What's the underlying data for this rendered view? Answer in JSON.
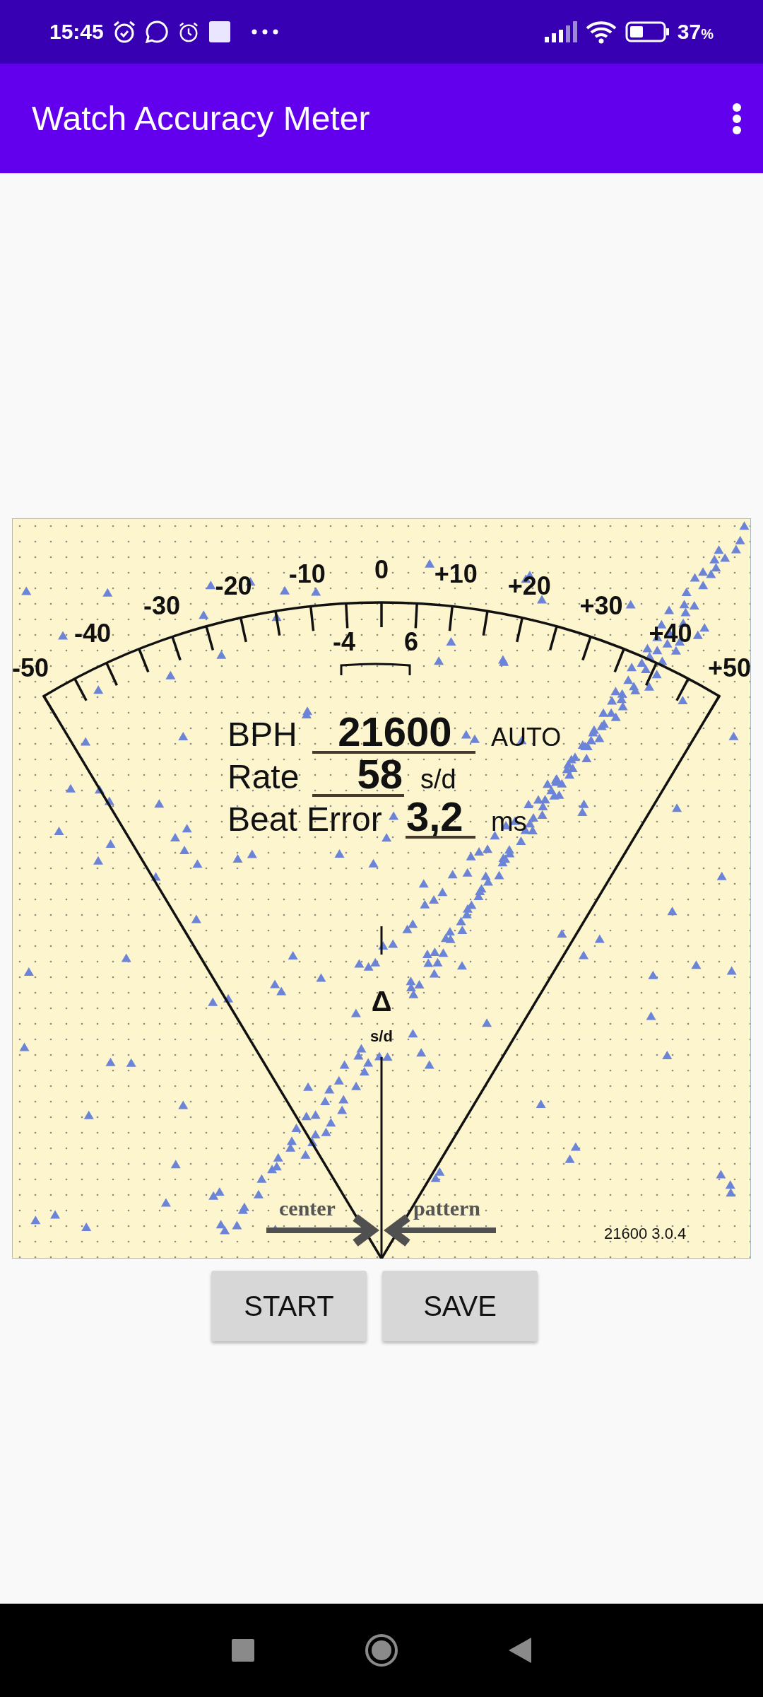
{
  "status_bar": {
    "time": "15:45",
    "battery": "37",
    "battery_unit": "%"
  },
  "app_bar": {
    "title": "Watch Accuracy Meter"
  },
  "dial": {
    "scale_labels": [
      "-50",
      "-40",
      "-30",
      "-20",
      "-10",
      "0",
      "+10",
      "+20",
      "+30",
      "+40",
      "+50"
    ],
    "bracket_labels": [
      "-4",
      "6"
    ],
    "readings": [
      {
        "label": "BPH",
        "value": "21600",
        "unit": "AUTO"
      },
      {
        "label": "Rate",
        "value": "58",
        "unit": "s/d"
      },
      {
        "label": "Beat Error",
        "value": "3,2",
        "unit": "ms"
      }
    ],
    "delta_symbol": "Δ",
    "delta_unit": "s/d",
    "arrow_labels": [
      "center",
      "pattern"
    ],
    "version": "21600 3.0.4"
  },
  "buttons": [
    "START",
    "SAVE"
  ]
}
